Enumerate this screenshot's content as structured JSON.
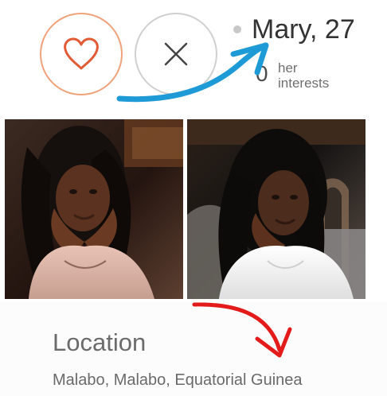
{
  "profile": {
    "name_age": "Mary, 27",
    "interest_count": "0",
    "interests_label": "her\ninterests"
  },
  "actions": {
    "like_icon": "heart-icon",
    "pass_icon": "close-icon"
  },
  "colors": {
    "like_border": "#f0a27b",
    "like_icon": "#e15b35",
    "pass_border": "#d0d0d0",
    "pass_icon": "#444444",
    "blue_annotation": "#1e9bd7",
    "red_annotation": "#e31b1b",
    "photo_dark": "#2c1e18"
  },
  "details": {
    "location_heading": "Location",
    "location_value": "Malabo, Malabo, Equatorial Guinea"
  }
}
